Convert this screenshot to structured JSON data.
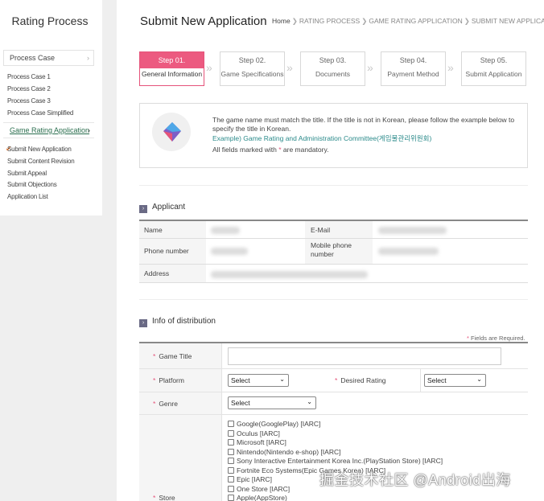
{
  "sidebar": {
    "title": "Rating Process",
    "process_case": "Process Case",
    "cases": [
      "Process Case 1",
      "Process Case 2",
      "Process Case 3",
      "Process Case Simplified"
    ],
    "group": "Game Rating Application",
    "items": [
      "Submit New Application",
      "Submit Content Revision",
      "Submit Appeal",
      "Submit Objections",
      "Application List"
    ]
  },
  "header": {
    "title": "Submit New Application",
    "breadcrumb": [
      "Home",
      "RATING PROCESS",
      "GAME RATING APPLICATION",
      "SUBMIT NEW APPLICATION"
    ]
  },
  "steps": [
    {
      "num": "Step 01.",
      "label": "General Information"
    },
    {
      "num": "Step 02.",
      "label": "Game Specifications"
    },
    {
      "num": "Step 03.",
      "label": "Documents"
    },
    {
      "num": "Step 04.",
      "label": "Payment Method"
    },
    {
      "num": "Step 05.",
      "label": "Submit Application"
    }
  ],
  "info": {
    "text": "The game name must match the title. If the title is not in Korean, please follow the example below to specify the title in Korean.",
    "example": "Example) Game Rating and Administration Committee(게임물관리위원회)",
    "mandatory_prefix": "All fields marked with",
    "mandatory_star": "*",
    "mandatory_suffix": "are mandatory."
  },
  "applicant": {
    "heading": "Applicant",
    "name_label": "Name",
    "email_label": "E-Mail",
    "phone_label": "Phone number",
    "mobile_label": "Mobile phone number",
    "address_label": "Address"
  },
  "distribution": {
    "heading": "Info of distribution",
    "required_note": "Fields are Required.",
    "required_star": "*",
    "star": "*",
    "game_title_label": "Game Title",
    "platform_label": "Platform",
    "platform_value": "Select",
    "desired_rating_label": "Desired Rating",
    "desired_rating_value": "Select",
    "genre_label": "Genre",
    "genre_value": "Select",
    "store_label": "Store",
    "stores": [
      "Google(GooglePlay) [IARC]",
      "Oculus [IARC]",
      "Microsoft [IARC]",
      "Nintendo(Nintendo e-shop) [IARC]",
      "Sony Interactive Entertainment Korea Inc.(PlayStation Store) [IARC]",
      "Fortnite Eco Systems(Epic Games Korea) [IARC]",
      "Epic [IARC]",
      "One Store [IARC]",
      "Apple(AppStore)"
    ]
  },
  "watermark": "掘金技术社区 @Android出海",
  "colors": {
    "accent": "#ec5a80",
    "link": "#2a6e4e",
    "section_box": "#6a6a85"
  }
}
